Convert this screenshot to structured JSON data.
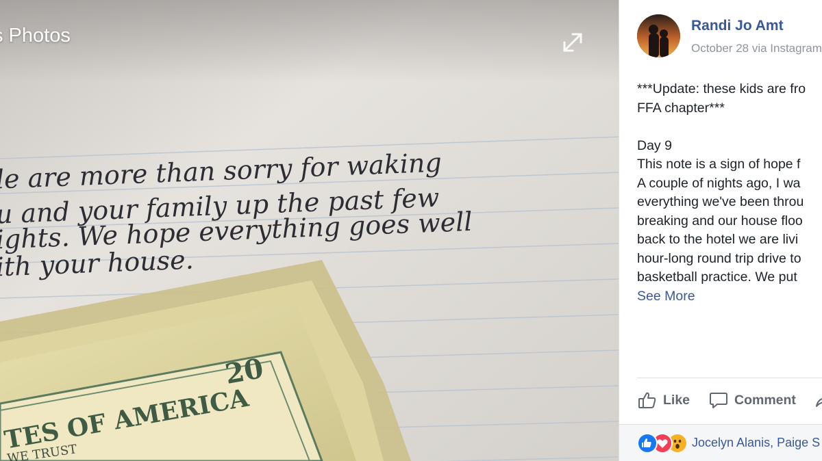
{
  "viewer": {
    "title": "s Photos",
    "note_lines": [
      "le are more than sorry for waking",
      "u and your family up the past few",
      "ights. We hope everything goes well",
      "ith your house."
    ],
    "bill_text": "TES OF AMERICA",
    "bill_motto": "WE TRUST",
    "bill_value": "20"
  },
  "post": {
    "author": "Randi Jo Amt",
    "meta": "October 28 via Instagram",
    "lines": [
      "***Update: these kids are fro",
      "FFA chapter***",
      "",
      "Day 9",
      "This note is a sign of hope f",
      "A couple of nights ago, I wa",
      "everything we've been throu",
      "breaking and our house floo",
      "back to the hotel we are livi",
      "hour-long round trip drive to",
      "basketball practice. We put"
    ],
    "see_more": "See More"
  },
  "actions": {
    "like": "Like",
    "comment": "Comment"
  },
  "reactions": {
    "names": "Jocelyn Alanis, Paige S",
    "colors": {
      "like": "#1877f2",
      "love": "#f33e58",
      "wow": "#f7b125"
    }
  },
  "colors": {
    "link": "#385898",
    "text": "#1d2129",
    "muted": "#90949c",
    "action": "#606770"
  }
}
